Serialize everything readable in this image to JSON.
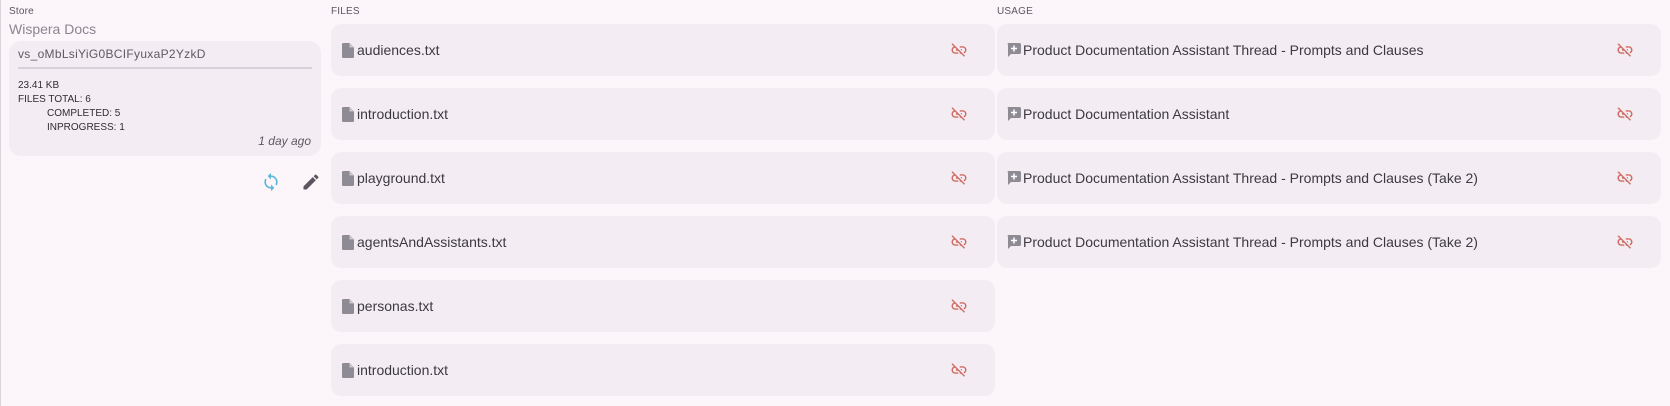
{
  "store": {
    "section_label": "Store",
    "name": "Wispera Docs",
    "id": "vs_oMbLsiYiG0BCIFyuxaP2YzkD",
    "size": "23.41 KB",
    "files_total": "FILES TOTAL: 6",
    "completed": "COMPLETED: 5",
    "inprogress": "INPROGRESS: 1",
    "updated": "1 day ago",
    "actions": {
      "refresh_icon": "refresh-icon",
      "edit_icon": "pencil-icon"
    }
  },
  "files": {
    "section_label": "FILES",
    "items": [
      {
        "label": "audiences.txt"
      },
      {
        "label": "introduction.txt"
      },
      {
        "label": "playground.txt"
      },
      {
        "label": "agentsAndAssistants.txt"
      },
      {
        "label": "personas.txt"
      },
      {
        "label": "introduction.txt"
      }
    ]
  },
  "usage": {
    "section_label": "USAGE",
    "items": [
      {
        "label": "Product Documentation Assistant Thread - Prompts and Clauses"
      },
      {
        "label": "Product Documentation Assistant"
      },
      {
        "label": "Product Documentation Assistant Thread - Prompts and Clauses (Take 2)"
      },
      {
        "label": "Product Documentation Assistant Thread - Prompts and Clauses (Take 2)"
      }
    ]
  },
  "colors": {
    "background": "#fcf6fb",
    "card": "#f3edf3",
    "refresh_accent": "#5bb8d9",
    "unlink_accent": "#d06b63"
  }
}
